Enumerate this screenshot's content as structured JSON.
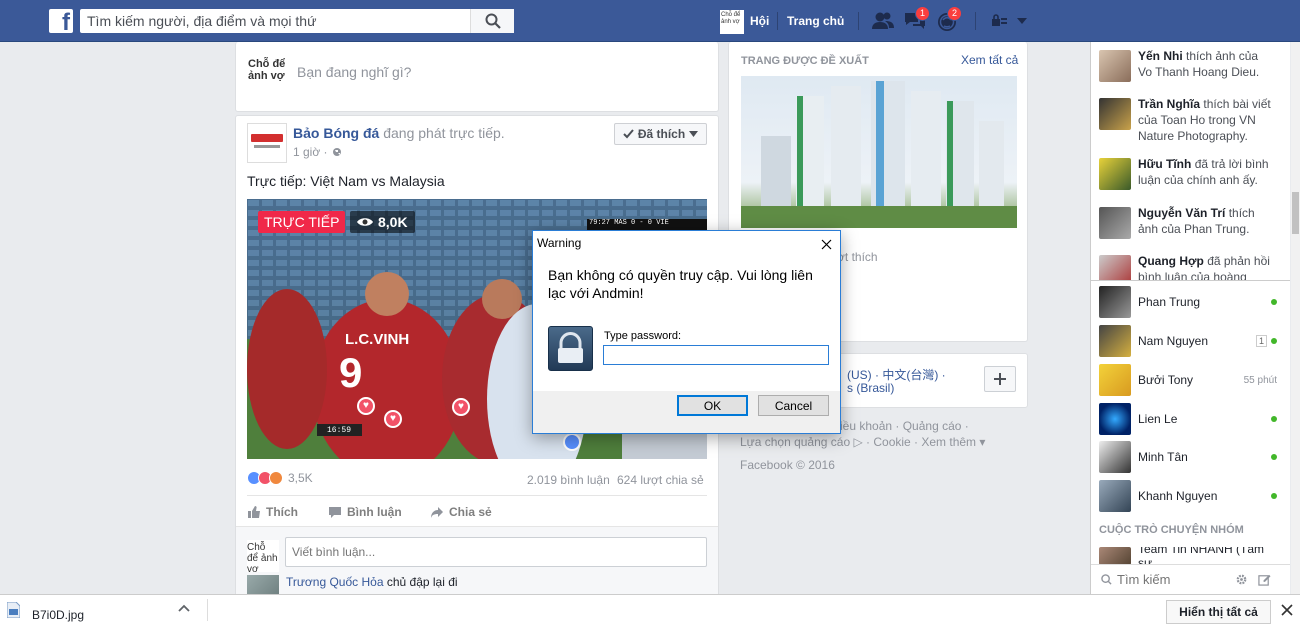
{
  "topbar": {
    "logo": "f",
    "search_placeholder": "Tìm kiếm người, địa điểm và mọi thứ",
    "profile_avatar": "Chỗ để ảnh vợ",
    "user_label": "Hội",
    "home_label": "Trang chủ",
    "messages_badge": "1",
    "notifications_badge": "2",
    "icons": [
      "search-icon",
      "friend-requests-icon",
      "messages-icon",
      "notifications-icon",
      "privacy-icon",
      "dropdown-icon"
    ]
  },
  "composer": {
    "avatar": "Chỗ để ảnh vợ",
    "placeholder": "Bạn đang nghĩ gì?"
  },
  "post": {
    "page_name": "Bảo Bóng đá",
    "action": "đang phát trực tiếp.",
    "time": "1 giờ ·",
    "liked_button": "Đã thích",
    "text": "Trực tiếp: Việt Nam vs Malaysia",
    "live_badge": "TRỰC TIẾP",
    "viewers": "8,0K",
    "scoreboard": "79:27  MAS  0 - 0  VIE",
    "jersey_name": "L.C.VINH",
    "jersey_number": "9",
    "video_time": "16:59",
    "reactions_count": "3,5K",
    "comments_count": "2.019 bình luận",
    "shares_count": "624 lượt chia sẻ",
    "actions": [
      "Thích",
      "Bình luận",
      "Chia sẻ"
    ],
    "comment_avatar": "Chỗ để ảnh vợ",
    "comment_placeholder": "Viết bình luận...",
    "reply_author": "Trương Quốc Hỏa",
    "reply_text": "chủ đập lại đi"
  },
  "right_column": {
    "suggested_title": "TRANG ĐƯỢC ĐỀ XUẤT",
    "see_all": "Xem tất cả",
    "likes_fragment": "ượt thích",
    "languages_line1": "(US) · 中文(台灣) ·",
    "languages_line2": "s (Brasil)",
    "footer_line1": "iều khoản · Quảng cáo ·",
    "footer_line2": "Lựa chọn quảng cáo ▷ · Cookie · Xem thêm ▾",
    "copyright": "Facebook © 2016"
  },
  "ticker": [
    {
      "name": "Yến Nhi",
      "text": "thích ảnh của Vo Thanh Hoang Dieu."
    },
    {
      "name": "Trần Nghĩa",
      "text": "thích bài viết của Toan Ho trong VN Nature Photography."
    },
    {
      "name": "Hữu Tĩnh",
      "text": "đã trả lời bình luận của chính anh ấy."
    },
    {
      "name": "Nguyễn Văn Trí",
      "text": "thích ảnh của Phan Trung."
    },
    {
      "name": "Quang Hợp",
      "text": "đã phản hồi bình luận của hoàng Đăm"
    }
  ],
  "chat": {
    "contacts": [
      {
        "name": "Phan Trung",
        "status": "online"
      },
      {
        "name": "Nam Nguyen",
        "status": "1"
      },
      {
        "name": "Bưởi Tony",
        "status": "55 phút"
      },
      {
        "name": "Lien Le",
        "status": "online"
      },
      {
        "name": "Minh Tân",
        "status": "online"
      },
      {
        "name": "Khanh Nguyen",
        "status": "online"
      }
    ],
    "group_header": "CUỘC TRÒ CHUYỆN NHÓM",
    "group_name": "Team Tin NHANH (Tâm sư...",
    "search_placeholder": "Tìm kiếm"
  },
  "dialog": {
    "title": "Warning",
    "message": "Bạn không có quyền truy cập. Vui lòng liên lạc với Andmin!",
    "password_label": "Type password:",
    "ok": "OK",
    "cancel": "Cancel"
  },
  "download_bar": {
    "filename": "B7i0D.jpg",
    "show_all": "Hiển thị tất cả"
  },
  "colors": {
    "brand": "#3b5998",
    "live": "#f02849",
    "online": "#42b72a",
    "dialog_border": "#2a7dd6"
  }
}
